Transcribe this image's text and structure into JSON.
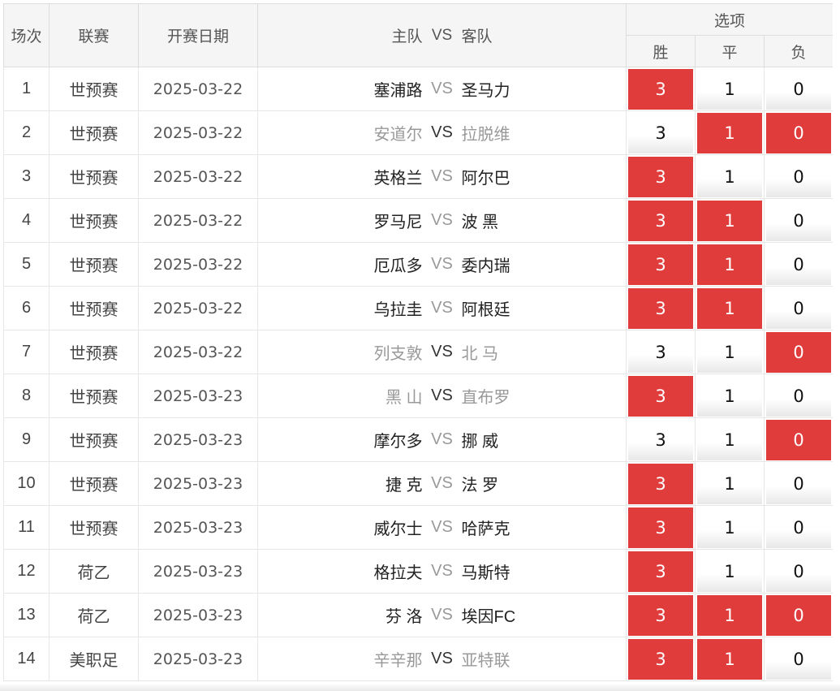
{
  "header": {
    "no": "场次",
    "league": "联赛",
    "date": "开赛日期",
    "home": "主队",
    "vs": "VS",
    "away": "客队",
    "options": "选项",
    "win": "胜",
    "draw": "平",
    "lose": "负"
  },
  "colors": {
    "selected": "#e03c3c",
    "dim_text": "#999999"
  },
  "matches": [
    {
      "no": "1",
      "league": "世预赛",
      "date": "2025-03-22",
      "home": "塞浦路",
      "vs": "VS",
      "away": "圣马力",
      "dim": false,
      "win": "3",
      "draw": "1",
      "lose": "0",
      "sel": [
        true,
        false,
        false
      ]
    },
    {
      "no": "2",
      "league": "世预赛",
      "date": "2025-03-22",
      "home": "安道尔",
      "vs": "VS",
      "away": "拉脱维",
      "dim": true,
      "win": "3",
      "draw": "1",
      "lose": "0",
      "sel": [
        false,
        true,
        true
      ]
    },
    {
      "no": "3",
      "league": "世预赛",
      "date": "2025-03-22",
      "home": "英格兰",
      "vs": "VS",
      "away": "阿尔巴",
      "dim": false,
      "win": "3",
      "draw": "1",
      "lose": "0",
      "sel": [
        true,
        false,
        false
      ]
    },
    {
      "no": "4",
      "league": "世预赛",
      "date": "2025-03-22",
      "home": "罗马尼",
      "vs": "VS",
      "away": "波 黑",
      "dim": false,
      "win": "3",
      "draw": "1",
      "lose": "0",
      "sel": [
        true,
        true,
        false
      ]
    },
    {
      "no": "5",
      "league": "世预赛",
      "date": "2025-03-22",
      "home": "厄瓜多",
      "vs": "VS",
      "away": "委内瑞",
      "dim": false,
      "win": "3",
      "draw": "1",
      "lose": "0",
      "sel": [
        true,
        true,
        false
      ]
    },
    {
      "no": "6",
      "league": "世预赛",
      "date": "2025-03-22",
      "home": "乌拉圭",
      "vs": "VS",
      "away": "阿根廷",
      "dim": false,
      "win": "3",
      "draw": "1",
      "lose": "0",
      "sel": [
        true,
        true,
        false
      ]
    },
    {
      "no": "7",
      "league": "世预赛",
      "date": "2025-03-22",
      "home": "列支敦",
      "vs": "VS",
      "away": "北 马",
      "dim": true,
      "win": "3",
      "draw": "1",
      "lose": "0",
      "sel": [
        false,
        false,
        true
      ]
    },
    {
      "no": "8",
      "league": "世预赛",
      "date": "2025-03-23",
      "home": "黑 山",
      "vs": "VS",
      "away": "直布罗",
      "dim": true,
      "win": "3",
      "draw": "1",
      "lose": "0",
      "sel": [
        true,
        false,
        false
      ]
    },
    {
      "no": "9",
      "league": "世预赛",
      "date": "2025-03-23",
      "home": "摩尔多",
      "vs": "VS",
      "away": "挪 威",
      "dim": false,
      "win": "3",
      "draw": "1",
      "lose": "0",
      "sel": [
        false,
        false,
        true
      ]
    },
    {
      "no": "10",
      "league": "世预赛",
      "date": "2025-03-23",
      "home": "捷 克",
      "vs": "VS",
      "away": "法 罗",
      "dim": false,
      "win": "3",
      "draw": "1",
      "lose": "0",
      "sel": [
        true,
        false,
        false
      ]
    },
    {
      "no": "11",
      "league": "世预赛",
      "date": "2025-03-23",
      "home": "威尔士",
      "vs": "VS",
      "away": "哈萨克",
      "dim": false,
      "win": "3",
      "draw": "1",
      "lose": "0",
      "sel": [
        true,
        false,
        false
      ]
    },
    {
      "no": "12",
      "league": "荷乙",
      "date": "2025-03-23",
      "home": "格拉夫",
      "vs": "VS",
      "away": "马斯特",
      "dim": false,
      "win": "3",
      "draw": "1",
      "lose": "0",
      "sel": [
        true,
        false,
        false
      ]
    },
    {
      "no": "13",
      "league": "荷乙",
      "date": "2025-03-23",
      "home": "芬 洛",
      "vs": "VS",
      "away": "埃因FC",
      "dim": false,
      "win": "3",
      "draw": "1",
      "lose": "0",
      "sel": [
        true,
        true,
        true
      ]
    },
    {
      "no": "14",
      "league": "美职足",
      "date": "2025-03-23",
      "home": "辛辛那",
      "vs": "VS",
      "away": "亚特联",
      "dim": true,
      "win": "3",
      "draw": "1",
      "lose": "0",
      "sel": [
        true,
        true,
        false
      ]
    }
  ]
}
